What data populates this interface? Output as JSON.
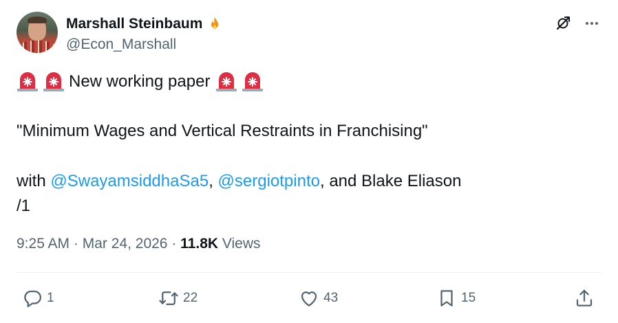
{
  "author": {
    "name": "Marshall Steinbaum",
    "handle": "@Econ_Marshall"
  },
  "tweet": {
    "line1_text": "New working paper",
    "line2": "\"Minimum Wages and Vertical Restraints in Franchising\"",
    "line3_prefix": "with ",
    "mention1": "@SwayamsiddhaSa5",
    "separator": ", ",
    "mention2": "@sergiotpinto",
    "line3_suffix": ", and Blake Eliason",
    "line4": "/1"
  },
  "meta": {
    "time": "9:25 AM",
    "dot1": " · ",
    "date": "Mar 24, 2026",
    "dot2": " · ",
    "views_count": "11.8K",
    "views_label": " Views"
  },
  "actions": {
    "replies": "1",
    "reposts": "22",
    "likes": "43",
    "bookmarks": "15"
  },
  "icons": {
    "header": [
      "grok-icon",
      "more-icon"
    ],
    "actions": [
      "reply-icon",
      "repost-icon",
      "like-icon",
      "bookmark-icon",
      "share-icon"
    ]
  },
  "colors": {
    "text": "#0f1419",
    "secondary": "#536471",
    "link": "#1d9bf0",
    "divider": "#eff3f4"
  }
}
